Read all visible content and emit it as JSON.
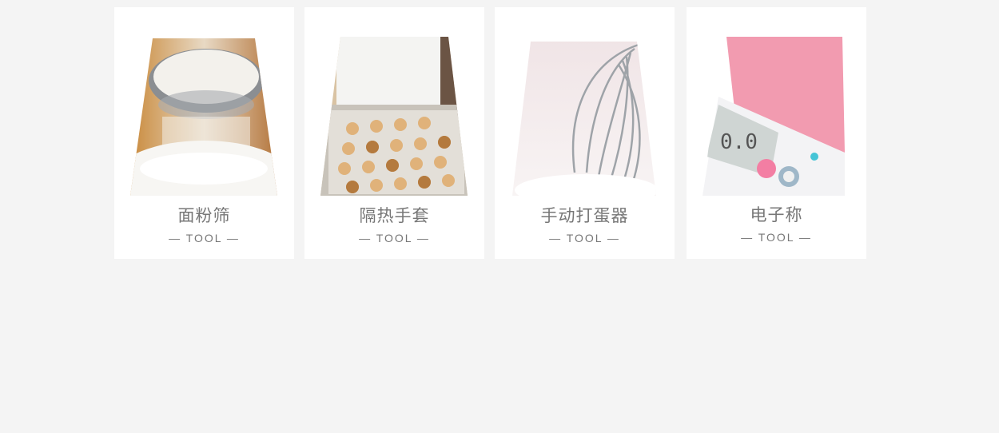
{
  "cards": [
    {
      "title": "面粉筛",
      "subtitle": "— TOOL —",
      "image": "flour-sieve-photo"
    },
    {
      "title": "隔热手套",
      "subtitle": "— TOOL —",
      "image": "baking-tray-cookies-photo"
    },
    {
      "title": "手动打蛋器",
      "subtitle": "— TOOL —",
      "image": "egg-whisk-photo"
    },
    {
      "title": "电子称",
      "subtitle": "— TOOL —",
      "image": "kitchen-scale-photo"
    }
  ],
  "colors": {
    "background": "#f4f4f4",
    "card": "#ffffff",
    "text": "#777777",
    "scale_pink": "#f29bb0"
  }
}
